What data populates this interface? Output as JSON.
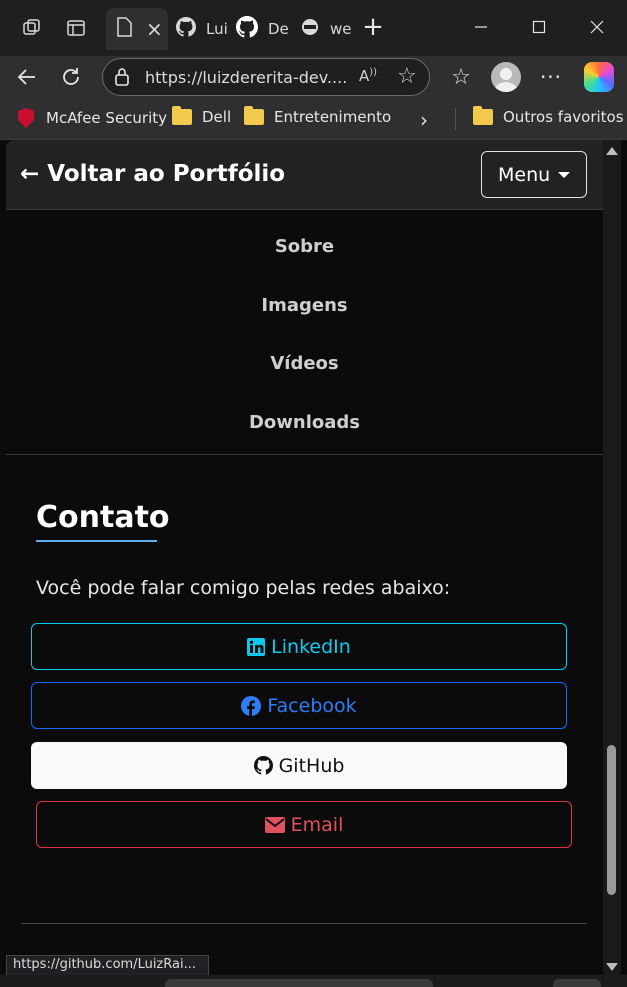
{
  "browser": {
    "tabs": [
      {
        "label": ""
      },
      {
        "label": "Lui"
      },
      {
        "label": "De"
      },
      {
        "label": "we"
      }
    ],
    "address": "https://luizdererita-dev....",
    "bookmarks": [
      {
        "label": "McAfee Security"
      },
      {
        "label": "Dell"
      },
      {
        "label": "Entretenimento"
      }
    ],
    "other_favorites": "Outros favoritos",
    "status_url": "https://github.com/LuizRai..."
  },
  "page": {
    "back_link": "← Voltar ao Portfólio",
    "menu_button": "Menu",
    "menu_items": [
      {
        "label": "Sobre"
      },
      {
        "label": "Imagens"
      },
      {
        "label": "Vídeos"
      },
      {
        "label": "Downloads"
      }
    ],
    "section_title": "Contato",
    "intro_text": "Você pode falar comigo pelas redes abaixo:",
    "social": {
      "linkedin": "LinkedIn",
      "facebook": "Facebook",
      "github": "GitHub",
      "email": "Email"
    }
  },
  "colors": {
    "background": "#0b0b0c",
    "navbar": "#202224",
    "accent_underline": "#5ab0f0",
    "linkedin": "#0dcaf0",
    "facebook": "#0d6efd",
    "email": "#dc3545"
  }
}
